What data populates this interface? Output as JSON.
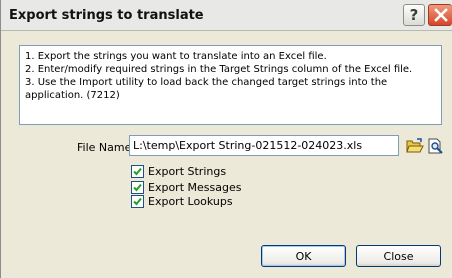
{
  "window": {
    "title": "Export strings to translate",
    "help_symbol": "?"
  },
  "instructions": [
    "1. Export the strings you want to translate into an Excel file.",
    "2. Enter/modify required strings in the Target Strings column of the Excel file.",
    "3. Use the Import utility to load back the changed target strings into the",
    "application. (7212)"
  ],
  "file": {
    "label": "File Name:",
    "value": "L:\\temp\\Export String-021512-024023.xls"
  },
  "options": [
    {
      "label": "Export Strings",
      "checked": true
    },
    {
      "label": "Export Messages",
      "checked": true
    },
    {
      "label": "Export Lookups",
      "checked": true
    }
  ],
  "buttons": {
    "ok": "OK",
    "close": "Close"
  },
  "colors": {
    "accent": "#d5462a",
    "check": "#21a121",
    "input_border": "#7f9db9"
  },
  "icons": [
    "help-icon",
    "close-icon",
    "open-folder-icon",
    "preview-icon",
    "checkmark-icon"
  ]
}
